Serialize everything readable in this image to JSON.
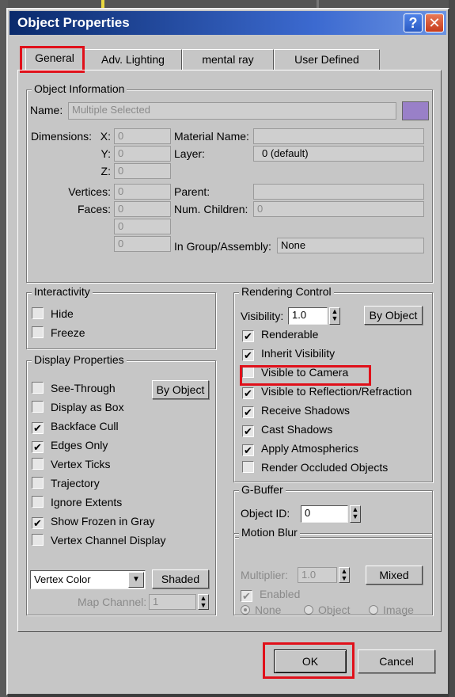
{
  "window": {
    "title": "Object Properties",
    "help_glyph": "?",
    "close_glyph": "✕"
  },
  "tabs": [
    "General",
    "Adv. Lighting",
    "mental ray",
    "User Defined"
  ],
  "object_info": {
    "title": "Object Information",
    "name_label": "Name:",
    "name_value": "Multiple Selected",
    "color_swatch": "#9980c8",
    "dimensions_label": "Dimensions:",
    "x_label": "X:",
    "x_value": "0",
    "y_label": "Y:",
    "y_value": "0",
    "z_label": "Z:",
    "z_value": "0",
    "vertices_label": "Vertices:",
    "vertices_value": "0",
    "faces_label": "Faces:",
    "faces_value": "0",
    "extra1_value": "0",
    "extra2_value": "0",
    "material_label": "Material Name:",
    "material_value": "",
    "layer_label": "Layer:",
    "layer_value": "0 (default)",
    "parent_label": "Parent:",
    "parent_value": "",
    "children_label": "Num. Children:",
    "children_value": "0",
    "group_label": "In Group/Assembly:",
    "group_value": "None"
  },
  "interactivity": {
    "title": "Interactivity",
    "hide": {
      "label": "Hide",
      "checked": false
    },
    "freeze": {
      "label": "Freeze",
      "checked": false
    }
  },
  "display": {
    "title": "Display Properties",
    "by_object": "By Object",
    "items": [
      {
        "label": "See-Through",
        "checked": false
      },
      {
        "label": "Display as Box",
        "checked": false
      },
      {
        "label": "Backface Cull",
        "checked": true
      },
      {
        "label": "Edges Only",
        "checked": true
      },
      {
        "label": "Vertex Ticks",
        "checked": false
      },
      {
        "label": "Trajectory",
        "checked": false
      },
      {
        "label": "Ignore Extents",
        "checked": false
      },
      {
        "label": "Show Frozen in Gray",
        "checked": true
      },
      {
        "label": "Vertex Channel Display",
        "checked": false
      }
    ],
    "vertex_select": "Vertex Color",
    "shaded": "Shaded",
    "map_channel_label": "Map Channel:",
    "map_channel_value": "1"
  },
  "rendering": {
    "title": "Rendering Control",
    "visibility_label": "Visibility:",
    "visibility_value": "1.0",
    "by_object": "By Object",
    "items": [
      {
        "label": "Renderable",
        "checked": true
      },
      {
        "label": "Inherit Visibility",
        "checked": true
      },
      {
        "label": "Visible to Camera",
        "checked": false
      },
      {
        "label": "Visible to Reflection/Refraction",
        "checked": true
      },
      {
        "label": "Receive Shadows",
        "checked": true
      },
      {
        "label": "Cast Shadows",
        "checked": true
      },
      {
        "label": "Apply Atmospherics",
        "checked": true
      },
      {
        "label": "Render Occluded Objects",
        "checked": false
      }
    ]
  },
  "gbuffer": {
    "title": "G-Buffer",
    "object_id_label": "Object ID:",
    "object_id_value": "0"
  },
  "motion_blur": {
    "title": "Motion Blur",
    "multiplier_label": "Multiplier:",
    "multiplier_value": "1.0",
    "mixed": "Mixed",
    "enabled_label": "Enabled",
    "radios": [
      "None",
      "Object",
      "Image"
    ],
    "selected": "None"
  },
  "footer": {
    "ok": "OK",
    "cancel": "Cancel"
  },
  "highlight_color": "#e0101a"
}
